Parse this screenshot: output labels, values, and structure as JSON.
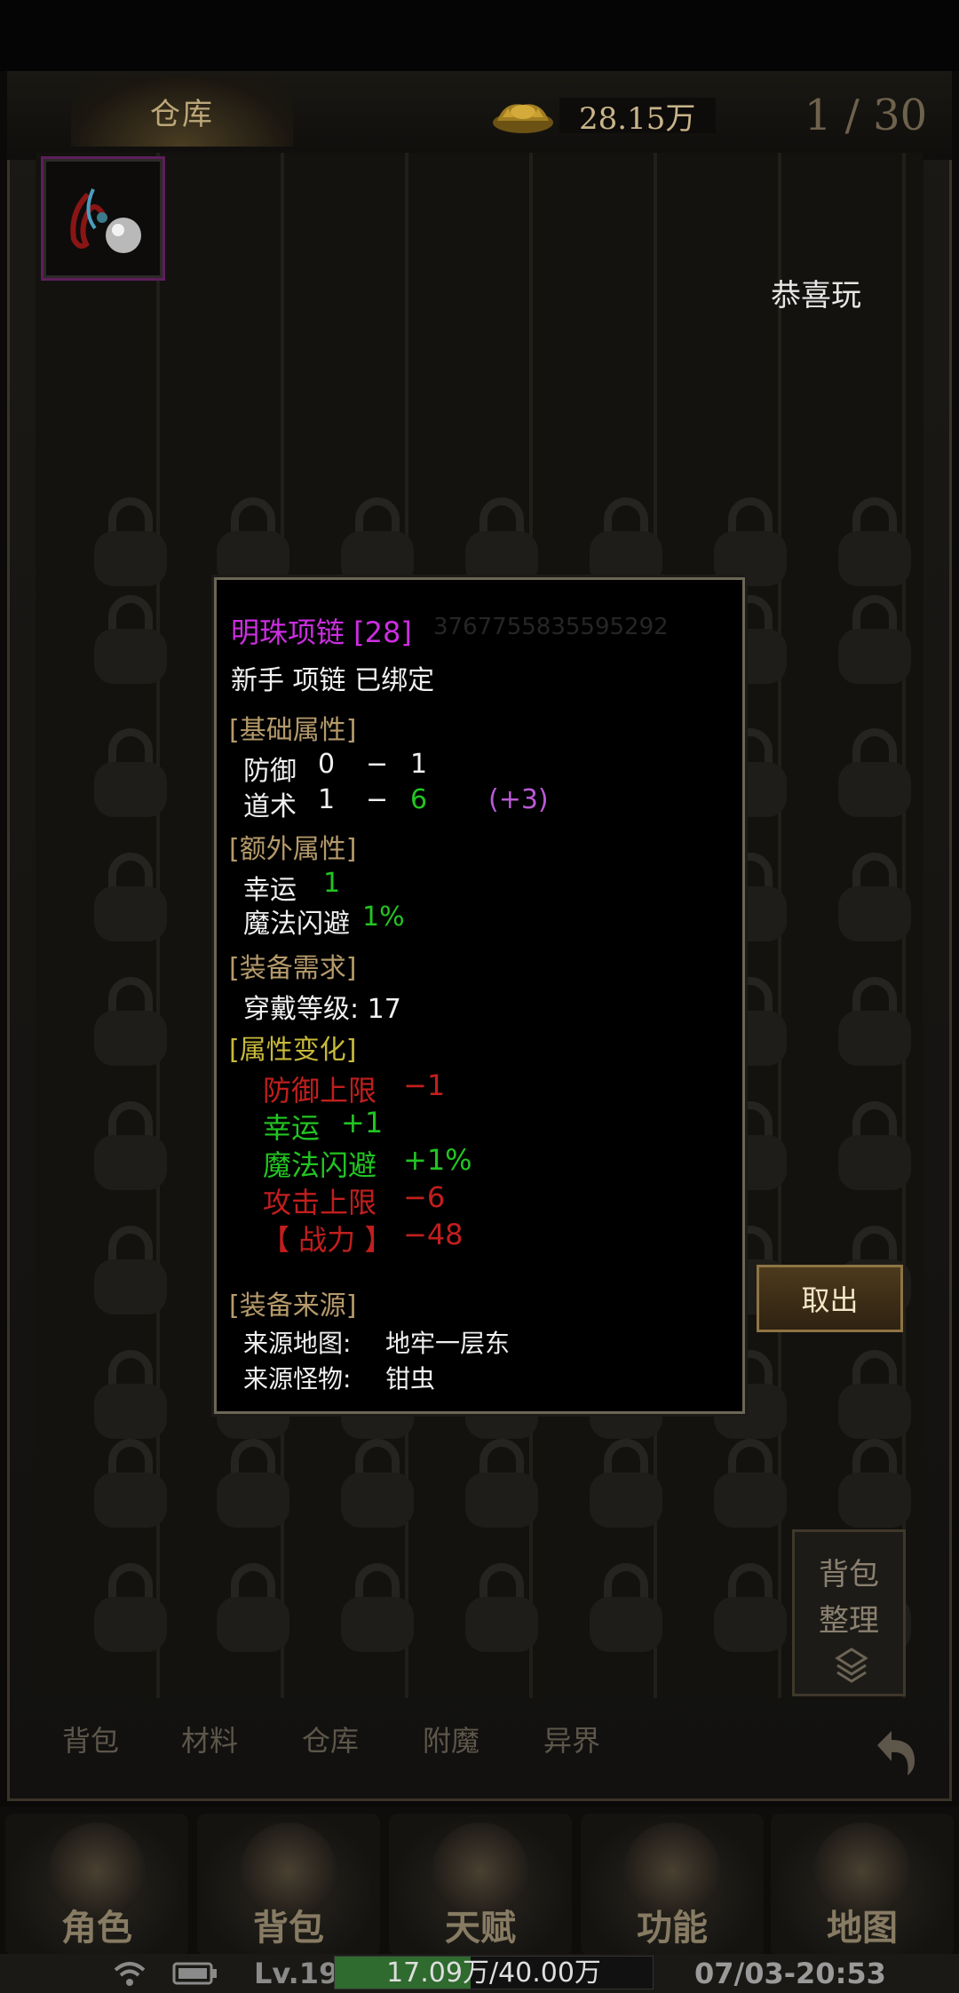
{
  "header": {
    "tab_label": "仓库",
    "gold": "28.15万",
    "page": "1 / 30"
  },
  "notice": "恭喜玩",
  "tooltip": {
    "name": "明珠项链 [28]",
    "item_id": "3767755835595292",
    "tags": "新手 项链 已绑定",
    "sections": {
      "base": "[基础属性]",
      "extra": "[额外属性]",
      "requirement": "[装备需求]",
      "change": "[属性变化]",
      "source": "[装备来源]"
    },
    "base_attrs": [
      {
        "name": "防御",
        "min": "0",
        "sep": "−",
        "max": "1",
        "bonus": ""
      },
      {
        "name": "道术",
        "min": "1",
        "sep": "−",
        "max": "6",
        "bonus": "(+3)"
      }
    ],
    "extra_attrs": [
      {
        "name": "幸运",
        "value": "1"
      },
      {
        "name": "魔法闪避",
        "value": "1%"
      }
    ],
    "requirement": "穿戴等级: 17",
    "changes": [
      {
        "name": "防御上限",
        "value": "−1",
        "color": "#c21e1e"
      },
      {
        "name": "幸运",
        "value": "+1",
        "color": "#22c522"
      },
      {
        "name": "魔法闪避",
        "value": "+1%",
        "color": "#22c522"
      },
      {
        "name": "攻击上限",
        "value": "−6",
        "color": "#c21e1e"
      },
      {
        "name": "【 战力 】",
        "value": "−48",
        "color": "#c21e1e"
      }
    ],
    "source_map_label": "来源地图:",
    "source_map": "地牢一层东",
    "source_monster_label": "来源怪物:",
    "source_monster": "钳虫"
  },
  "buttons": {
    "take_out": "取出",
    "organize_line1": "背包",
    "organize_line2": "整理"
  },
  "bag_tabs": [
    "背包",
    "材料",
    "仓库",
    "附魔",
    "异界"
  ],
  "main_nav": [
    "角色",
    "背包",
    "天赋",
    "功能",
    "地图"
  ],
  "status": {
    "level": "Lv.19",
    "xp": "17.09万/40.00万",
    "xp_fraction": 0.427,
    "datetime": "07/03-20:53"
  },
  "icons": [
    "gold-ingot-icon",
    "lock-icon",
    "necklace-item-icon",
    "layers-icon",
    "back-arrow-icon",
    "wifi-icon",
    "battery-icon"
  ]
}
